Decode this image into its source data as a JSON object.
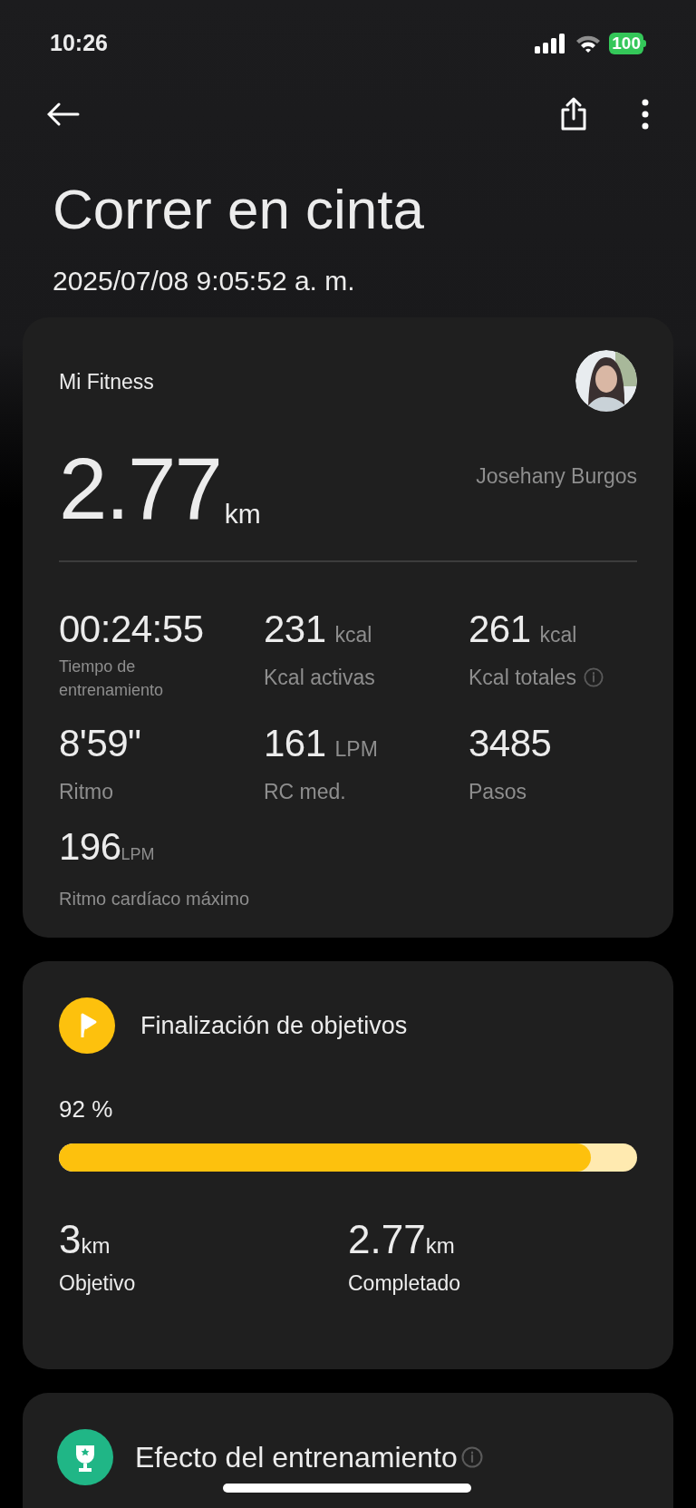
{
  "status_bar": {
    "time": "10:26",
    "battery": "100"
  },
  "title": "Correr en cinta",
  "datetime": "2025/07/08 9:05:52 a. m.",
  "summary": {
    "source": "Mi Fitness",
    "user": "Josehany Burgos",
    "distance": {
      "value": "2.77",
      "unit": "km"
    },
    "stats": [
      {
        "kind": "twoline",
        "value": "00:24:55",
        "label": "Tiempo de entrenamiento",
        "info": false
      },
      {
        "kind": "spaced",
        "value": "231",
        "unit": "kcal",
        "label": "Kcal activas",
        "info": false
      },
      {
        "kind": "spaced",
        "value": "261",
        "unit": "kcal",
        "label": "Kcal totales",
        "info": true
      },
      {
        "kind": "spaced",
        "value": "8'59\"",
        "label": "Ritmo",
        "info": false
      },
      {
        "kind": "spaced",
        "value": "161",
        "unit": "LPM",
        "label": "RC med.",
        "info": false
      },
      {
        "kind": "spaced",
        "value": "3485",
        "label": "Pasos",
        "info": false
      },
      {
        "kind": "compact",
        "value": "196",
        "unit": "LPM",
        "label": "Ritmo cardíaco máximo",
        "info": false
      }
    ]
  },
  "goal": {
    "title": "Finalización de objetivos",
    "percent": "92 %",
    "level": 0.92,
    "items": [
      {
        "value": "3",
        "unit": "km",
        "label": "Objetivo"
      },
      {
        "value": "2.77",
        "unit": "km",
        "label": "Completado"
      }
    ]
  },
  "effect": {
    "title": "Efecto del entrenamiento",
    "info": true
  }
}
